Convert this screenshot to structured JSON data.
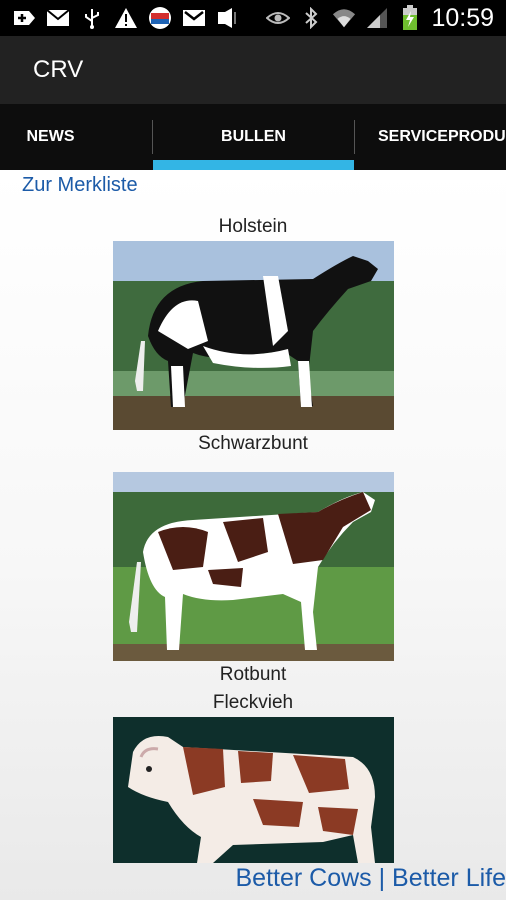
{
  "status_bar": {
    "time": "10:59",
    "left_icons": [
      "add-icon",
      "mail-icon",
      "usb-icon",
      "warning-icon",
      "flag-icon",
      "gmail-icon",
      "speaker-icon"
    ],
    "right_icons": [
      "eye-icon",
      "bluetooth-icon",
      "wifi-icon",
      "signal-icon",
      "battery-icon"
    ]
  },
  "app": {
    "title": "CRV"
  },
  "tabs": [
    {
      "label": "NEWS",
      "selected": false
    },
    {
      "label": "BULLEN",
      "selected": true
    },
    {
      "label": "SERVICEPRODUKTE",
      "selected": false
    }
  ],
  "colors": {
    "accent": "#33b5e5",
    "link": "#1c5ba8"
  },
  "content": {
    "merkliste_link": "Zur Merkliste",
    "sections": [
      {
        "title": "Holstein"
      },
      {
        "title": "Fleckvieh"
      }
    ],
    "images": [
      {
        "caption": "Schwarzbunt",
        "icon": "holstein-black-white-cow-image"
      },
      {
        "caption": "Rotbunt",
        "icon": "holstein-red-white-cow-image"
      },
      {
        "caption": "",
        "icon": "fleckvieh-cow-image"
      }
    ],
    "slogan": "Better Cows | Better Life"
  }
}
